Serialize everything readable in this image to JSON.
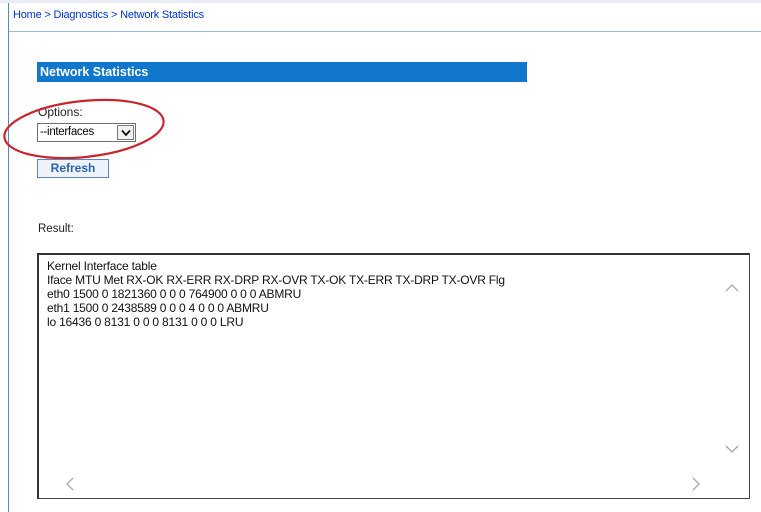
{
  "breadcrumb": {
    "home": "Home",
    "diagnostics": "Diagnostics",
    "current": "Network Statistics",
    "separator": ">"
  },
  "section": {
    "title": "Network Statistics"
  },
  "options": {
    "label": "Options:",
    "selected": "--interfaces"
  },
  "refresh": {
    "label": "Refresh"
  },
  "result": {
    "label": "Result:",
    "lines": [
      "Kernel Interface table",
      "Iface MTU Met RX-OK RX-ERR RX-DRP RX-OVR TX-OK TX-ERR TX-DRP TX-OVR Flg",
      "eth0 1500 0 1821360 0 0 0 764900 0 0 0 ABMRU",
      "eth1 1500 0 2438589 0 0 0 4 0 0 0 ABMRU",
      "lo 16436 0 8131 0 0 0 8131 0 0 0 LRU"
    ]
  },
  "colors": {
    "header_bg": "#1177cc",
    "link": "#0033cc",
    "highlight_ellipse": "#c8262c"
  },
  "icons": {
    "select_arrow": "chevron-down-icon",
    "scroll_up": "chevron-up-icon",
    "scroll_down": "chevron-down-icon",
    "scroll_left": "chevron-left-icon",
    "scroll_right": "chevron-right-icon"
  }
}
